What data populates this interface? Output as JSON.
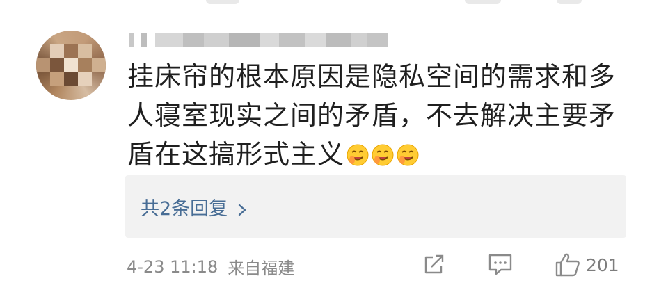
{
  "comment": {
    "text": "挂床帘的根本原因是隐私空间的需求和多人寝室现实之间的矛盾，不去解决主要矛盾在这搞形式主义",
    "emoji_count": 3,
    "emoji_icon": "drooling-face-icon"
  },
  "replies": {
    "label": "共2条回复",
    "chevron_icon": "chevron-right-icon",
    "link_color": "#486d95"
  },
  "meta": {
    "time": "4-23 11:18",
    "source": "来自福建"
  },
  "actions": {
    "share_icon": "share-icon",
    "comment_icon": "comment-icon",
    "like_icon": "thumbs-up-icon",
    "like_count": "201"
  }
}
